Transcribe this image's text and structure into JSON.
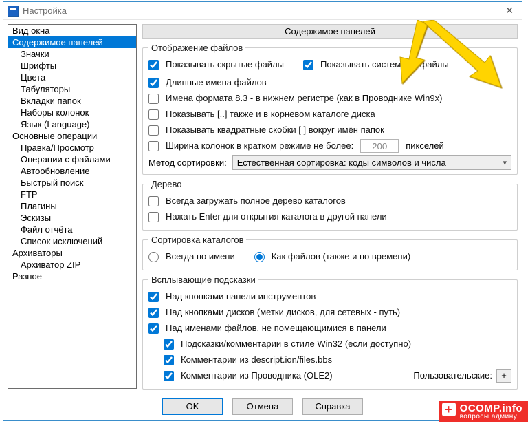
{
  "title": "Настройка",
  "heading": "Содержимое панелей",
  "nav": {
    "items": [
      {
        "label": "Вид окна",
        "indent": false
      },
      {
        "label": "Содержимое панелей",
        "indent": false,
        "selected": true
      },
      {
        "label": "Значки",
        "indent": true
      },
      {
        "label": "Шрифты",
        "indent": true
      },
      {
        "label": "Цвета",
        "indent": true
      },
      {
        "label": "Табуляторы",
        "indent": true
      },
      {
        "label": "Вкладки папок",
        "indent": true
      },
      {
        "label": "Наборы колонок",
        "indent": true
      },
      {
        "label": "Язык (Language)",
        "indent": true
      },
      {
        "label": "Основные операции",
        "indent": false
      },
      {
        "label": "Правка/Просмотр",
        "indent": true
      },
      {
        "label": "Операции с файлами",
        "indent": true
      },
      {
        "label": "Автообновление",
        "indent": true
      },
      {
        "label": "Быстрый поиск",
        "indent": true
      },
      {
        "label": "FTP",
        "indent": true
      },
      {
        "label": "Плагины",
        "indent": true
      },
      {
        "label": "Эскизы",
        "indent": true
      },
      {
        "label": "Файл отчёта",
        "indent": true
      },
      {
        "label": "Список исключений",
        "indent": true
      },
      {
        "label": "Архиваторы",
        "indent": false
      },
      {
        "label": "Архиватор ZIP",
        "indent": true
      },
      {
        "label": "Разное",
        "indent": false
      }
    ]
  },
  "groups": {
    "display": {
      "legend": "Отображение файлов",
      "show_hidden": "Показывать скрытые файлы",
      "show_system": "Показывать системные файлы",
      "long_names": "Длинные имена файлов",
      "names83": "Имена формата 8.3 - в нижнем регистре (как в Проводнике Win9x)",
      "parent_root": "Показывать [..] также и в корневом каталоге диска",
      "brackets": "Показывать квадратные скобки [ ] вокруг имён папок",
      "colwidth_pre": "Ширина колонок в кратком режиме не более:",
      "colwidth_val": "200",
      "colwidth_post": "пикселей",
      "sort_label": "Метод сортировки:",
      "sort_value": "Естественная сортировка: коды символов и числа"
    },
    "tree": {
      "legend": "Дерево",
      "full_tree": "Всегда загружать полное дерево каталогов",
      "enter_open": "Нажать Enter для открытия каталога в другой панели"
    },
    "dirsort": {
      "legend": "Сортировка каталогов",
      "by_name": "Всегда по имени",
      "like_files": "Как файлов (также и по времени)"
    },
    "tooltips": {
      "legend": "Всплывающие подсказки",
      "over_toolbar": "Над кнопками панели инструментов",
      "over_drives": "Над кнопками дисков (метки дисков, для сетевых - путь)",
      "over_names": "Над именами файлов, не помещающимися в панели",
      "win32": "Подсказки/комментарии в стиле Win32 (если доступно)",
      "descript": "Комментарии из descript.ion/files.bbs",
      "ole2": "Комментарии из Проводника (OLE2)",
      "custom_label": "Пользовательские:",
      "plus": "+"
    }
  },
  "buttons": {
    "ok": "OK",
    "cancel": "Отмена",
    "help": "Справка"
  },
  "watermark": {
    "big": "OCOMP.info",
    "small": "вопросы админу"
  }
}
